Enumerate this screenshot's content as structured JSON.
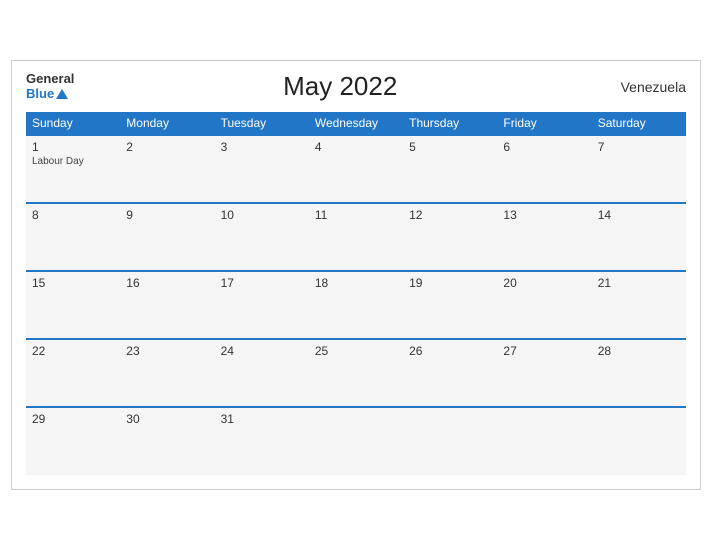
{
  "header": {
    "logo_general": "General",
    "logo_blue": "Blue",
    "month_title": "May 2022",
    "country": "Venezuela"
  },
  "weekdays": [
    "Sunday",
    "Monday",
    "Tuesday",
    "Wednesday",
    "Thursday",
    "Friday",
    "Saturday"
  ],
  "weeks": [
    [
      {
        "day": "1",
        "holiday": "Labour Day"
      },
      {
        "day": "2",
        "holiday": ""
      },
      {
        "day": "3",
        "holiday": ""
      },
      {
        "day": "4",
        "holiday": ""
      },
      {
        "day": "5",
        "holiday": ""
      },
      {
        "day": "6",
        "holiday": ""
      },
      {
        "day": "7",
        "holiday": ""
      }
    ],
    [
      {
        "day": "8",
        "holiday": ""
      },
      {
        "day": "9",
        "holiday": ""
      },
      {
        "day": "10",
        "holiday": ""
      },
      {
        "day": "11",
        "holiday": ""
      },
      {
        "day": "12",
        "holiday": ""
      },
      {
        "day": "13",
        "holiday": ""
      },
      {
        "day": "14",
        "holiday": ""
      }
    ],
    [
      {
        "day": "15",
        "holiday": ""
      },
      {
        "day": "16",
        "holiday": ""
      },
      {
        "day": "17",
        "holiday": ""
      },
      {
        "day": "18",
        "holiday": ""
      },
      {
        "day": "19",
        "holiday": ""
      },
      {
        "day": "20",
        "holiday": ""
      },
      {
        "day": "21",
        "holiday": ""
      }
    ],
    [
      {
        "day": "22",
        "holiday": ""
      },
      {
        "day": "23",
        "holiday": ""
      },
      {
        "day": "24",
        "holiday": ""
      },
      {
        "day": "25",
        "holiday": ""
      },
      {
        "day": "26",
        "holiday": ""
      },
      {
        "day": "27",
        "holiday": ""
      },
      {
        "day": "28",
        "holiday": ""
      }
    ],
    [
      {
        "day": "29",
        "holiday": ""
      },
      {
        "day": "30",
        "holiday": ""
      },
      {
        "day": "31",
        "holiday": ""
      },
      {
        "day": "",
        "holiday": ""
      },
      {
        "day": "",
        "holiday": ""
      },
      {
        "day": "",
        "holiday": ""
      },
      {
        "day": "",
        "holiday": ""
      }
    ]
  ]
}
